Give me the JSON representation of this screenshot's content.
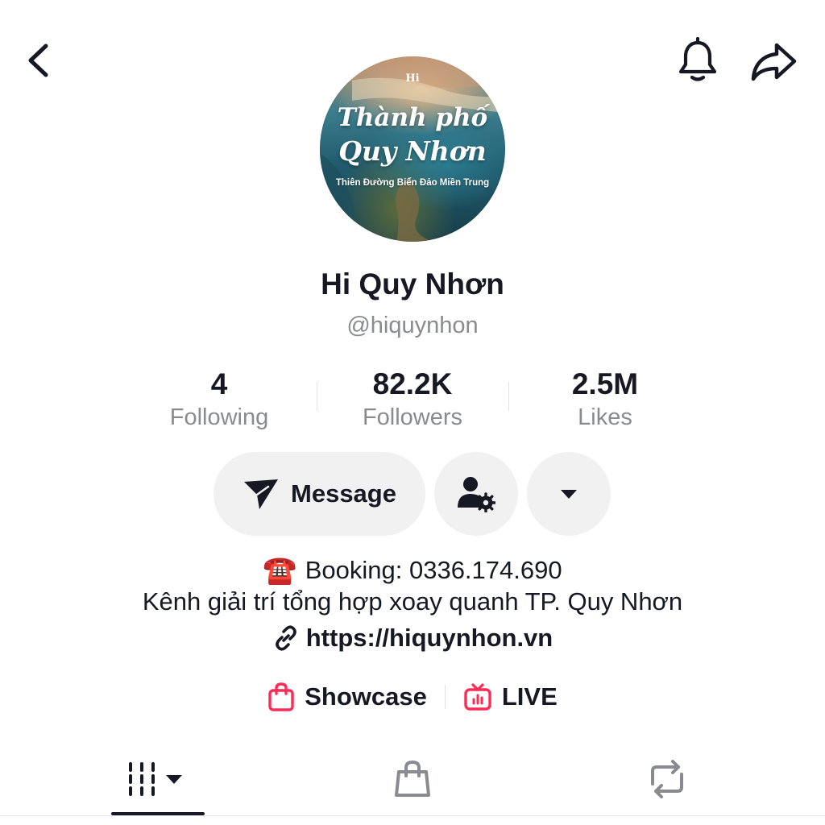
{
  "header": {
    "back_icon": "chevron-left-icon",
    "bell_icon": "bell-icon",
    "share_icon": "share-arrow-icon"
  },
  "avatar": {
    "logo": "Hi",
    "line1": "Thành phố",
    "line2": "Quy Nhơn",
    "tagline": "Thiên Đường Biển Đảo Miền Trung"
  },
  "profile": {
    "name": "Hi Quy Nhơn",
    "handle": "@hiquynhon"
  },
  "stats": [
    {
      "value": "4",
      "label": "Following"
    },
    {
      "value": "82.2K",
      "label": "Followers"
    },
    {
      "value": "2.5M",
      "label": "Likes"
    }
  ],
  "actions": {
    "message_label": "Message",
    "message_icon": "send-icon",
    "friend_icon": "user-settings-icon",
    "more_icon": "caret-down-icon"
  },
  "bio": {
    "line1_emoji": "☎️",
    "line1": "Booking: 0336.174.690",
    "line2": "Kênh giải trí tổng hợp xoay quanh TP. Quy Nhơn",
    "link": "https://hiquynhon.vn",
    "link_icon": "link-icon"
  },
  "links": {
    "showcase_label": "Showcase",
    "live_label": "LIVE",
    "accent_color": "#fe2c55"
  },
  "tabs": [
    {
      "icon": "videos-grid-icon",
      "active": true
    },
    {
      "icon": "shopping-bag-icon",
      "active": false
    },
    {
      "icon": "repost-icon",
      "active": false
    }
  ]
}
